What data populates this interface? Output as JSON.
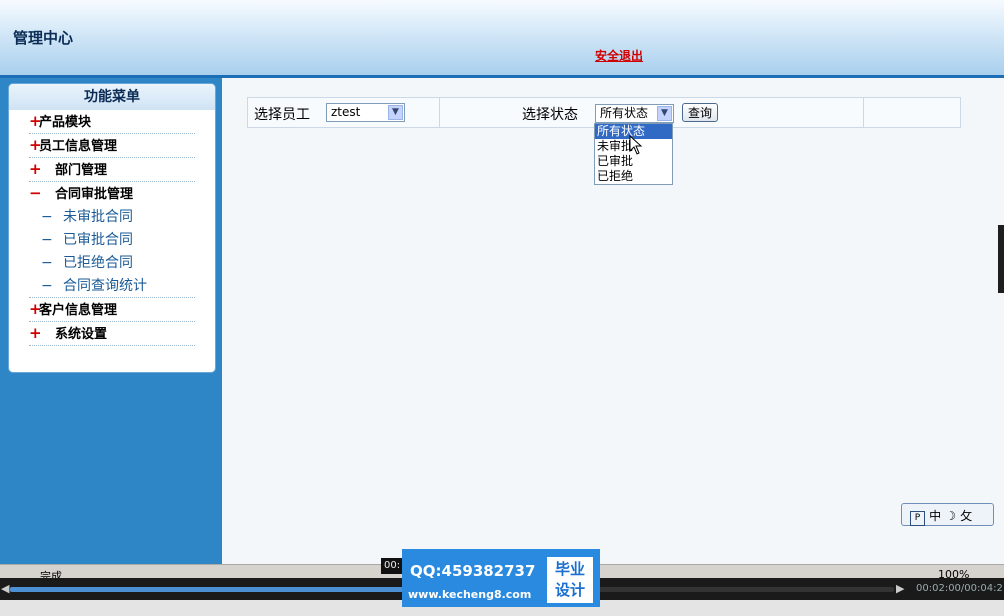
{
  "header": {
    "title": "管理中心",
    "logout": "安全退出"
  },
  "menu": {
    "title": "功能菜单",
    "items": [
      {
        "sign": "+",
        "label": "产品模块"
      },
      {
        "sign": "+",
        "label": "员工信息管理"
      },
      {
        "sign": "+",
        "label": "部门管理"
      },
      {
        "sign": "−",
        "label": "合同审批管理"
      }
    ],
    "subitems": [
      {
        "sign": "−",
        "label": "未审批合同"
      },
      {
        "sign": "−",
        "label": "已审批合同"
      },
      {
        "sign": "−",
        "label": "已拒绝合同"
      },
      {
        "sign": "−",
        "label": "合同查询统计"
      }
    ],
    "items_after": [
      {
        "sign": "+",
        "label": "客户信息管理"
      },
      {
        "sign": "+",
        "label": "系统设置"
      }
    ]
  },
  "filter": {
    "employee_label": "选择员工",
    "employee_value": "ztest",
    "status_label": "选择状态",
    "status_value": "所有状态",
    "query_button": "查询",
    "status_options": [
      "所有状态",
      "未审批",
      "已审批",
      "已拒绝"
    ]
  },
  "ime": {
    "p": "P",
    "lang": "中",
    "moon": "☽",
    "punct": "⺙"
  },
  "status_bar": {
    "text": "完成",
    "zoom": "100%"
  },
  "player": {
    "time": "00:02:00/00:04:2",
    "tip": "00:",
    "progress": 0.46
  },
  "watermark": {
    "qq": "QQ:459382737",
    "url": "www.kecheng8.com",
    "box_line1": "毕业",
    "box_line2": "设计"
  }
}
